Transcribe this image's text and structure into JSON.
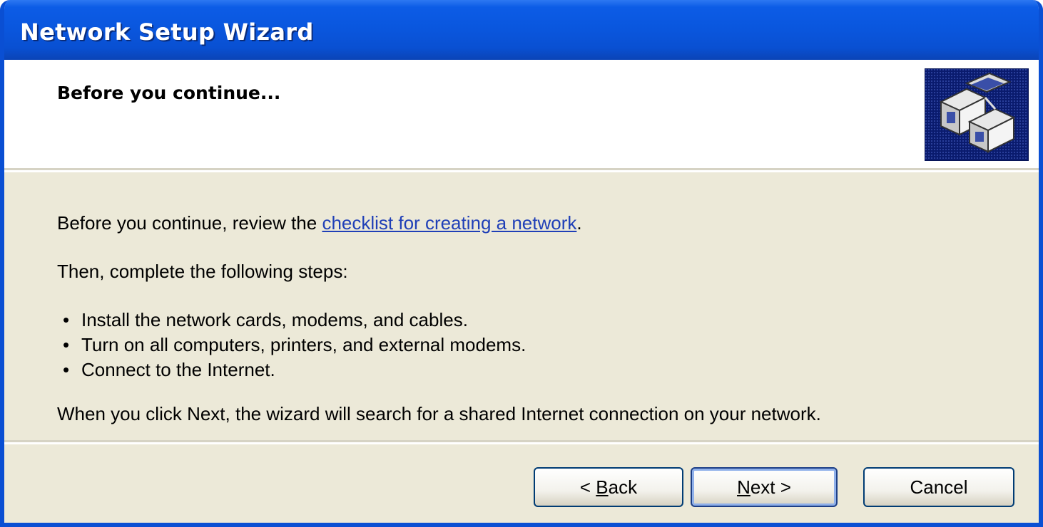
{
  "window": {
    "title": "Network Setup Wizard"
  },
  "header": {
    "title": "Before you continue...",
    "icon": "network-computers-icon"
  },
  "body": {
    "line1_prefix": "Before you continue, review the ",
    "line1_link": "checklist for creating a network",
    "line1_suffix": ".",
    "line2": "Then, complete the following steps:",
    "steps": [
      "Install the network cards, modems, and cables.",
      "Turn on all computers, printers, and external modems.",
      "Connect to the Internet."
    ],
    "line3": "When you click Next, the wizard will search for a shared Internet connection on your network."
  },
  "buttons": {
    "back_prefix": "< ",
    "back_mnemonic": "B",
    "back_rest": "ack",
    "next_mnemonic": "N",
    "next_rest": "ext >",
    "cancel": "Cancel"
  },
  "colors": {
    "titlebar": "#0a56dd",
    "dialog_bg": "#ece9d8",
    "link": "#1f3fb7"
  }
}
